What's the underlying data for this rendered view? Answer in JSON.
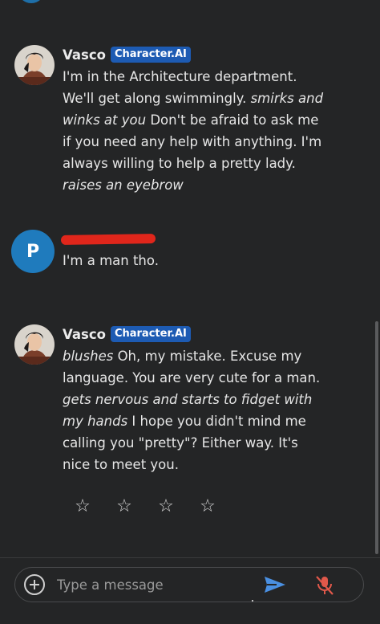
{
  "messages": [
    {
      "sender": "Vasco",
      "badge": "Character.AI",
      "segments": [
        {
          "text": "I'm in the Architecture department. We'll get along swimmingly. ",
          "italic": false
        },
        {
          "text": "smirks and winks at you",
          "italic": true
        },
        {
          "text": " Don't be afraid to ask me if you need any help with anything. I'm always willing to help a pretty lady. ",
          "italic": false
        },
        {
          "text": "raises an eyebrow",
          "italic": true
        }
      ]
    },
    {
      "sender_initial": "P",
      "sender_redacted": true,
      "text": "I'm a man tho."
    },
    {
      "sender": "Vasco",
      "badge": "Character.AI",
      "segments": [
        {
          "text": "blushes",
          "italic": true
        },
        {
          "text": " Oh, my mistake. Excuse my language. You are very cute for a man. ",
          "italic": false
        },
        {
          "text": "gets nervous and starts to fidget with my hands",
          "italic": true
        },
        {
          "text": " I hope you didn't mind me calling you \"pretty\"? Either way. It's nice to meet you.",
          "italic": false
        }
      ]
    }
  ],
  "rating": {
    "stars": [
      "☆",
      "☆",
      "☆",
      "☆"
    ]
  },
  "composer": {
    "placeholder": "Type a message",
    "value": "",
    "add_icon": "plus-circle-icon",
    "send_icon": "send-arrow-icon",
    "mic_icon": "mic-off-icon"
  },
  "colors": {
    "background": "#242526",
    "badge": "#1d5bb3",
    "user_avatar": "#1f7bbd",
    "send": "#4a90e2",
    "mic_off": "#e0584a"
  }
}
